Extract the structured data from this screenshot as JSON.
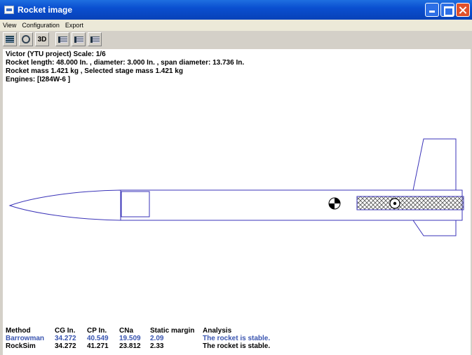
{
  "window": {
    "title": "Rocket image"
  },
  "menu": [
    "View",
    "Configuration",
    "Export"
  ],
  "toolbar": {
    "three_d_label": "3D"
  },
  "info": {
    "line1": "Victor (YTU project) Scale: 1/6",
    "line2": "Rocket length: 48.000  In. , diameter: 3.000  In. , span diameter: 13.736  In.",
    "line3": "Rocket mass 1.421 kg , Selected stage mass 1.421 kg",
    "line4": "Engines: [I284W-6  ]"
  },
  "stability_table": {
    "headers": [
      "Method",
      "CG In.",
      "CP In.",
      "CNa",
      "Static margin",
      "Analysis"
    ],
    "rows": [
      [
        "Barrowman",
        "34.272",
        "40.549",
        "19.509",
        "2.09",
        "The rocket is stable."
      ],
      [
        "RockSim",
        "34.272",
        "41.271",
        "23.812",
        "2.33",
        "The rocket is stable."
      ]
    ]
  },
  "colors": {
    "rocket_outline": "#3a33b8",
    "barrowman_text": "#3a55b0"
  }
}
